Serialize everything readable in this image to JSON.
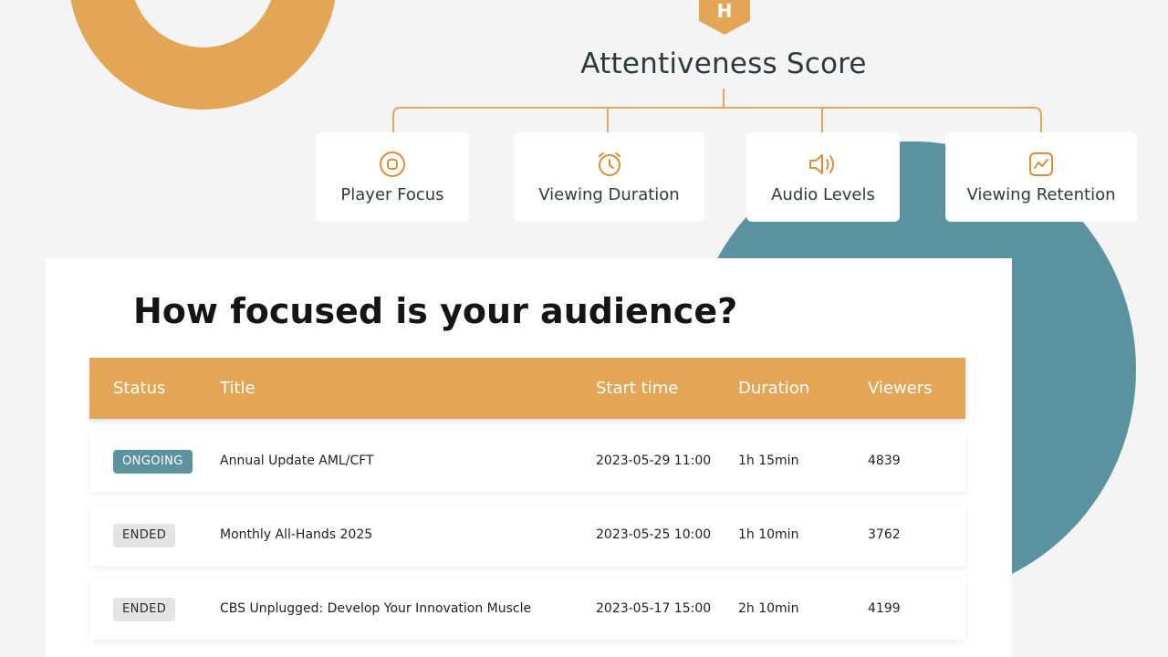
{
  "brand": {
    "logo_letter": "H",
    "accent": "#e3a556",
    "teal": "#5b929f"
  },
  "score": {
    "title": "Attentiveness Score",
    "metrics": [
      {
        "label": "Player Focus",
        "icon": "target-icon"
      },
      {
        "label": "Viewing Duration",
        "icon": "alarm-clock-icon"
      },
      {
        "label": "Audio Levels",
        "icon": "speaker-icon"
      },
      {
        "label": "Viewing Retention",
        "icon": "trend-chart-icon"
      }
    ]
  },
  "panel": {
    "title": "How focused is your audience?",
    "columns": {
      "status": "Status",
      "title": "Title",
      "start": "Start time",
      "duration": "Duration",
      "viewers": "Viewers"
    },
    "rows": [
      {
        "status": "ONGOING",
        "title": "Annual Update AML/CFT",
        "start": "2023-05-29 11:00",
        "duration": "1h 15min",
        "viewers": "4839"
      },
      {
        "status": "ENDED",
        "title": "Monthly All-Hands 2025",
        "start": "2023-05-25 10:00",
        "duration": "1h 10min",
        "viewers": "3762"
      },
      {
        "status": "ENDED",
        "title": "CBS Unplugged: Develop Your Innovation Muscle",
        "start": "2023-05-17 15:00",
        "duration": "2h 10min",
        "viewers": "4199"
      }
    ]
  }
}
